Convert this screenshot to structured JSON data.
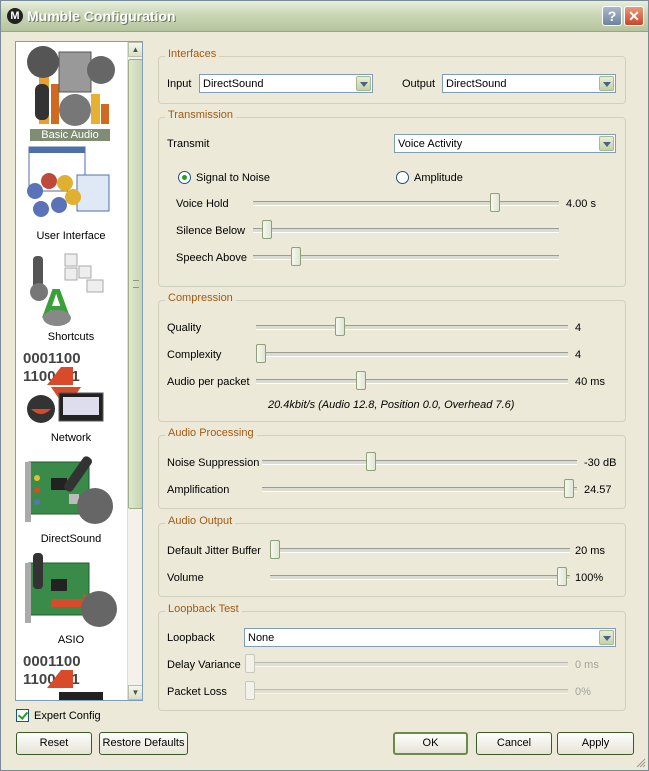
{
  "window": {
    "title": "Mumble Configuration",
    "help_glyph": "?",
    "close_glyph": "✕"
  },
  "colors": {
    "accent": "#a35a12",
    "selection": "#808c74",
    "check_green": "#21a121"
  },
  "sidebar": {
    "items": [
      {
        "label": "Basic Audio",
        "icon": "microphone-audio-icon",
        "selected": true
      },
      {
        "label": "User Interface",
        "icon": "user-interface-icon",
        "selected": false
      },
      {
        "label": "Shortcuts",
        "icon": "keyboard-shortcuts-icon",
        "selected": false
      },
      {
        "label": "Network",
        "icon": "network-icon",
        "selected": false
      },
      {
        "label": "DirectSound",
        "icon": "directsound-card-icon",
        "selected": false
      },
      {
        "label": "ASIO",
        "icon": "asio-card-icon",
        "selected": false
      }
    ],
    "network_bits": [
      "0001100",
      "1100011"
    ]
  },
  "interfaces": {
    "title": "Interfaces",
    "input_label": "Input",
    "input_value": "DirectSound",
    "output_label": "Output",
    "output_value": "DirectSound"
  },
  "transmission": {
    "title": "Transmission",
    "transmit_label": "Transmit",
    "transmit_value": "Voice Activity",
    "signal_to_noise": "Signal to Noise",
    "amplitude": "Amplitude",
    "voice_hold_label": "Voice Hold",
    "voice_hold_value": "4.00 s",
    "voice_hold_pos": 0.8,
    "silence_below_label": "Silence Below",
    "silence_below_pos": 0.03,
    "speech_above_label": "Speech Above",
    "speech_above_pos": 0.13
  },
  "compression": {
    "title": "Compression",
    "quality_label": "Quality",
    "quality_value": "4",
    "quality_pos": 0.26,
    "complexity_label": "Complexity",
    "complexity_value": "4",
    "complexity_pos": 0.0,
    "audio_per_packet_label": "Audio per packet",
    "audio_per_packet_value": "40 ms",
    "audio_per_packet_pos": 0.33,
    "bitrate_info": "20.4kbit/s (Audio 12.8, Position 0.0, Overhead 7.6)"
  },
  "audio_processing": {
    "title": "Audio Processing",
    "noise_suppression_label": "Noise Suppression",
    "noise_suppression_value": "-30 dB",
    "noise_suppression_pos": 0.34,
    "amplification_label": "Amplification",
    "amplification_value": "24.57",
    "amplification_pos": 0.99
  },
  "audio_output": {
    "title": "Audio Output",
    "jitter_label": "Default Jitter Buffer",
    "jitter_value": "20 ms",
    "jitter_pos": 0.0,
    "volume_label": "Volume",
    "volume_value": "100%",
    "volume_pos": 0.99
  },
  "loopback": {
    "title": "Loopback Test",
    "loopback_label": "Loopback",
    "loopback_value": "None",
    "delay_variance_label": "Delay Variance",
    "delay_variance_value": "0 ms",
    "delay_variance_pos": 0.0,
    "packet_loss_label": "Packet Loss",
    "packet_loss_value": "0%",
    "packet_loss_pos": 0.0
  },
  "footer": {
    "expert_config": "Expert Config",
    "reset": "Reset",
    "restore_defaults": "Restore Defaults",
    "ok": "OK",
    "cancel": "Cancel",
    "apply": "Apply"
  }
}
